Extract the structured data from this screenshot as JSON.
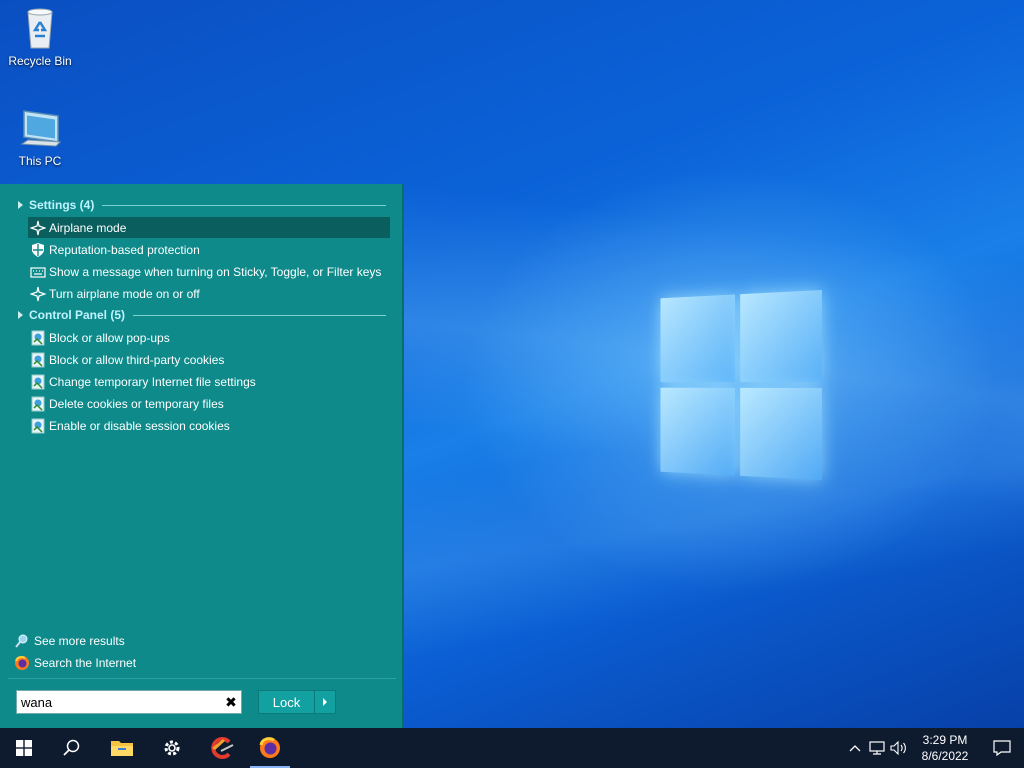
{
  "desktop": {
    "icons": [
      {
        "label": "Recycle Bin",
        "icon": "recycle-bin-icon"
      },
      {
        "label": "This PC",
        "icon": "this-pc-icon"
      }
    ]
  },
  "search_menu": {
    "groups": [
      {
        "header": "Settings (4)",
        "items": [
          {
            "label": "Airplane mode",
            "icon": "airplane-icon",
            "selected": true
          },
          {
            "label": "Reputation-based protection",
            "icon": "shield-icon"
          },
          {
            "label": "Show a message when turning on Sticky, Toggle, or Filter keys",
            "icon": "keyboard-icon"
          },
          {
            "label": "Turn airplane mode on or off",
            "icon": "airplane-icon"
          }
        ]
      },
      {
        "header": "Control Panel (5)",
        "items": [
          {
            "label": "Block or allow pop-ups",
            "icon": "internet-options-icon"
          },
          {
            "label": "Block or allow third-party cookies",
            "icon": "internet-options-icon"
          },
          {
            "label": "Change temporary Internet file settings",
            "icon": "internet-options-icon"
          },
          {
            "label": "Delete cookies or temporary files",
            "icon": "internet-options-icon"
          },
          {
            "label": "Enable or disable session cookies",
            "icon": "internet-options-icon"
          }
        ]
      }
    ],
    "see_more": "See more results",
    "search_internet": "Search the Internet",
    "query": "wana",
    "lock_label": "Lock"
  },
  "taskbar": {
    "buttons": [
      "start-icon",
      "search-icon",
      "file-explorer-icon",
      "settings-gear-icon",
      "ccleaner-icon",
      "firefox-icon"
    ],
    "clock_time": "3:29 PM",
    "clock_date": "8/6/2022"
  },
  "colors": {
    "menu_bg": "#0e8a8a",
    "menu_selected": "#0b5e5e",
    "group_header": "#bff3ff",
    "taskbar_bg": "#0e1b2e",
    "desktop_blue": "#0b63d8"
  }
}
